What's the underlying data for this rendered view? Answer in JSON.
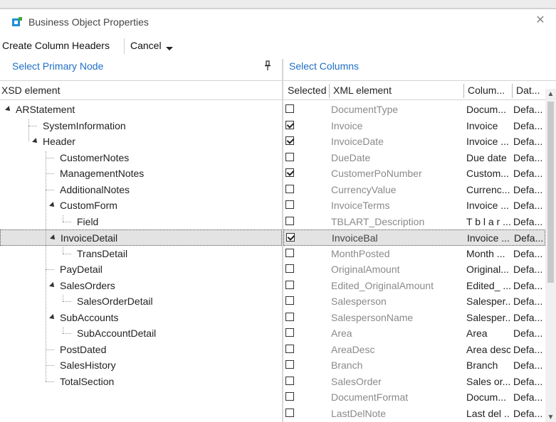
{
  "window": {
    "title": "Business Object Properties",
    "close_glyph": "✕"
  },
  "toolbar": {
    "create_label": "Create Column Headers",
    "cancel_label": "Cancel"
  },
  "left_pane": {
    "heading": "Select Primary Node",
    "column_header": "XSD element",
    "nodes": [
      {
        "label": "ARStatement",
        "level": 0,
        "expander": true
      },
      {
        "label": "SystemInformation",
        "level": 1,
        "expander": false
      },
      {
        "label": "Header",
        "level": 1,
        "expander": true
      },
      {
        "label": "CustomerNotes",
        "level": 2,
        "expander": false
      },
      {
        "label": "ManagementNotes",
        "level": 2,
        "expander": false
      },
      {
        "label": "AdditionalNotes",
        "level": 2,
        "expander": false
      },
      {
        "label": "CustomForm",
        "level": 2,
        "expander": true
      },
      {
        "label": "Field",
        "level": 3,
        "expander": false
      },
      {
        "label": "InvoiceDetail",
        "level": 2,
        "expander": true,
        "selected": true
      },
      {
        "label": "TransDetail",
        "level": 3,
        "expander": false
      },
      {
        "label": "PayDetail",
        "level": 2,
        "expander": false
      },
      {
        "label": "SalesOrders",
        "level": 2,
        "expander": true
      },
      {
        "label": "SalesOrderDetail",
        "level": 3,
        "expander": false
      },
      {
        "label": "SubAccounts",
        "level": 2,
        "expander": true
      },
      {
        "label": "SubAccountDetail",
        "level": 3,
        "expander": false
      },
      {
        "label": "PostDated",
        "level": 2,
        "expander": false
      },
      {
        "label": "SalesHistory",
        "level": 2,
        "expander": false
      },
      {
        "label": "TotalSection",
        "level": 2,
        "expander": false
      }
    ]
  },
  "right_pane": {
    "heading": "Select Columns",
    "columns": [
      "Selected",
      "XML element",
      "Colum...",
      "Dat..."
    ],
    "rows": [
      {
        "selected": false,
        "xml": "DocumentType",
        "col": "Docum...",
        "dat": "Defa..."
      },
      {
        "selected": true,
        "xml": "Invoice",
        "col": "Invoice",
        "dat": "Defa..."
      },
      {
        "selected": true,
        "xml": "InvoiceDate",
        "col": "Invoice ...",
        "dat": "Defa..."
      },
      {
        "selected": false,
        "xml": "DueDate",
        "col": "Due date",
        "dat": "Defa..."
      },
      {
        "selected": true,
        "xml": "CustomerPoNumber",
        "col": "Custom...",
        "dat": "Defa..."
      },
      {
        "selected": false,
        "xml": "CurrencyValue",
        "col": "Currenc...",
        "dat": "Defa..."
      },
      {
        "selected": false,
        "xml": "InvoiceTerms",
        "col": "Invoice ...",
        "dat": "Defa..."
      },
      {
        "selected": false,
        "xml": "TBLART_Description",
        "col": "T b l a r ...",
        "dat": "Defa..."
      },
      {
        "selected": true,
        "xml": "InvoiceBal",
        "col": "Invoice ...",
        "dat": "Defa...",
        "highlight": true
      },
      {
        "selected": false,
        "xml": "MonthPosted",
        "col": "Month ...",
        "dat": "Defa..."
      },
      {
        "selected": false,
        "xml": "OriginalAmount",
        "col": "Original...",
        "dat": "Defa..."
      },
      {
        "selected": false,
        "xml": "Edited_OriginalAmount",
        "col": "Edited_ ...",
        "dat": "Defa..."
      },
      {
        "selected": false,
        "xml": "Salesperson",
        "col": "Salesper...",
        "dat": "Defa..."
      },
      {
        "selected": false,
        "xml": "SalespersonName",
        "col": "Salesper...",
        "dat": "Defa..."
      },
      {
        "selected": false,
        "xml": "Area",
        "col": "Area",
        "dat": "Defa..."
      },
      {
        "selected": false,
        "xml": "AreaDesc",
        "col": "Area desc",
        "dat": "Defa..."
      },
      {
        "selected": false,
        "xml": "Branch",
        "col": "Branch",
        "dat": "Defa..."
      },
      {
        "selected": false,
        "xml": "SalesOrder",
        "col": "Sales or...",
        "dat": "Defa..."
      },
      {
        "selected": false,
        "xml": "DocumentFormat",
        "col": "Docum...",
        "dat": "Defa..."
      },
      {
        "selected": false,
        "xml": "LastDelNote",
        "col": "Last del ...",
        "dat": "Defa..."
      }
    ]
  },
  "colors": {
    "accent": "#1f6fc5",
    "icon_blue": "#1f8fd6",
    "icon_green": "#3aaa35"
  },
  "icons": [
    "app-icon",
    "close-icon",
    "pin-icon",
    "chevron-down-icon",
    "expander-icon",
    "checkbox-icon",
    "scroll-up-icon",
    "scroll-down-icon"
  ]
}
